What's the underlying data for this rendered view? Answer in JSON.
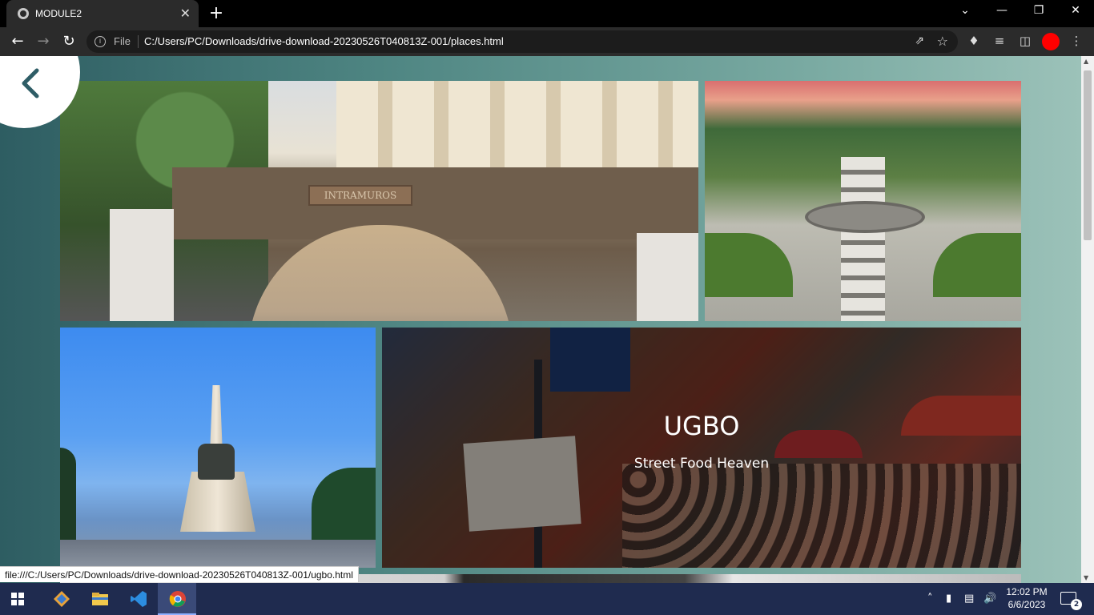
{
  "browser": {
    "tab_title": "MODULE2",
    "tab_close": "✕",
    "new_tab": "+",
    "win_controls": {
      "dropdown": "⌄",
      "minimize": "—",
      "restore": "❐",
      "close": "✕"
    },
    "scheme_label": "File",
    "url": "C:/Users/PC/Downloads/drive-download-20230526T040813Z-001/places.html",
    "status_link": "file:///C:/Users/PC/Downloads/drive-download-20230526T040813Z-001/ugbo.html",
    "profile_color": "#ff0000"
  },
  "page": {
    "back_icon": "chevron-left-icon",
    "cards": {
      "intramuros": {
        "sign": "INTRAMUROS"
      },
      "ugbo": {
        "title": "UGBO",
        "subtitle": "Street Food Heaven"
      }
    }
  },
  "taskbar": {
    "apps": [
      "git-gui",
      "file-explorer",
      "vscode",
      "chrome"
    ],
    "time": "12:02 PM",
    "date": "6/6/2023",
    "notification_count": "2"
  }
}
